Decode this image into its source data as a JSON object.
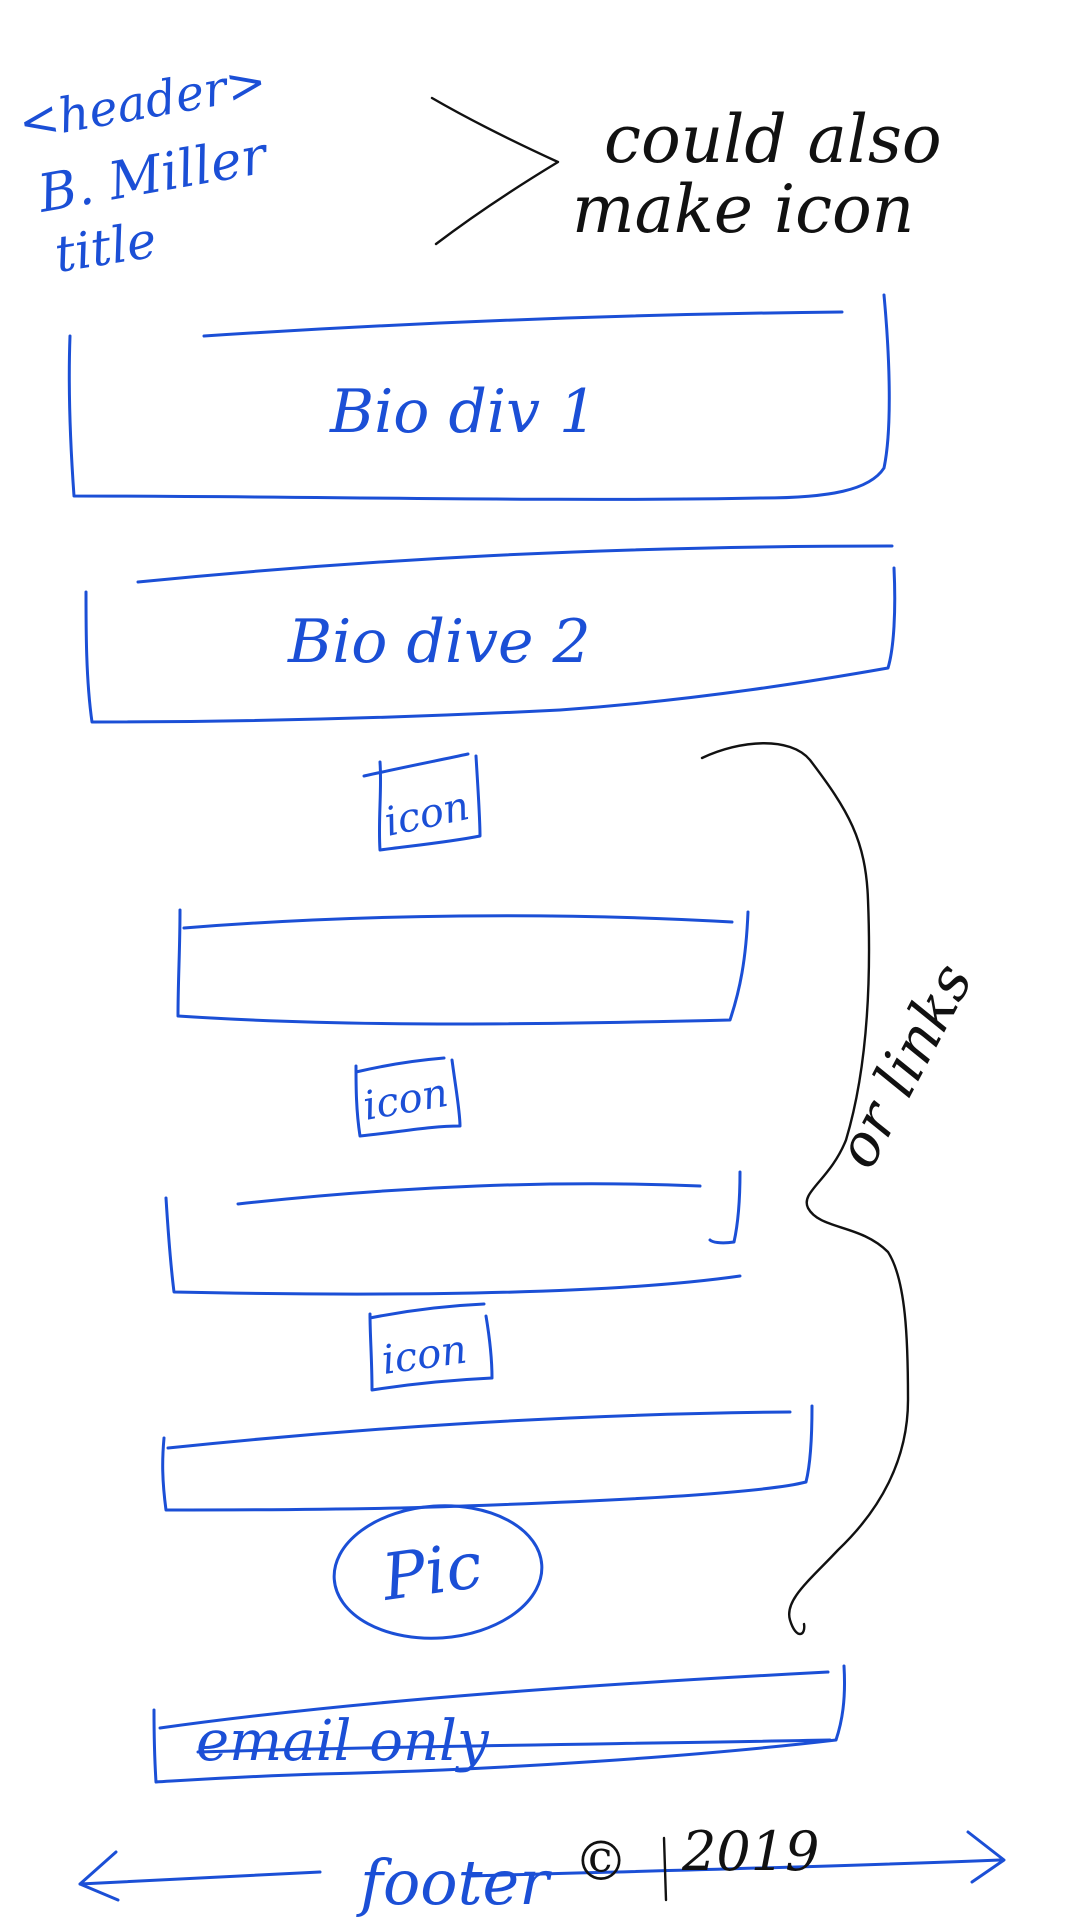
{
  "header_note": {
    "tag": "<header>",
    "name": "B. Miller",
    "title": "title"
  },
  "side_note": {
    "line1": "could also",
    "line2": "make icon"
  },
  "bio_sections": [
    {
      "label": "Bio div 1"
    },
    {
      "label": "Bio dive 2"
    }
  ],
  "icon_labels": [
    "icon",
    "icon",
    "icon"
  ],
  "links_note": "or links",
  "pic_label": "Pic",
  "email_label": "email only",
  "footer": {
    "label": "footer",
    "copyright": "©",
    "year": "2019"
  },
  "colors": {
    "sketch_blue": "#1b4fd6",
    "annotation_black": "#111111"
  }
}
